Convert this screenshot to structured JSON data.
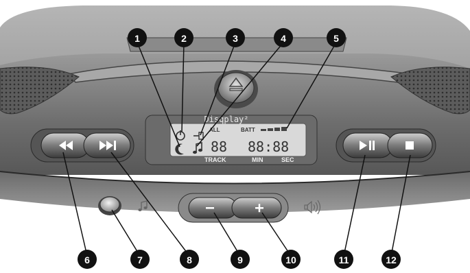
{
  "brand": "Disqplay²",
  "display": {
    "indicator_all": "ALL",
    "indicator_batt": "BATT",
    "digits_track": "88",
    "digits_time": "88:88",
    "label_track": "TRACK",
    "label_min": "MIN",
    "label_sec": "SEC"
  },
  "callouts": [
    "1",
    "2",
    "3",
    "4",
    "5",
    "6",
    "7",
    "8",
    "9",
    "10",
    "11",
    "12"
  ],
  "icons": {
    "sleep": "moon-icon",
    "power": "power-icon",
    "dc_in": "plug-icon",
    "anti_skip": "note-icon",
    "eject": "eject-icon",
    "rewind": "rewind-icon",
    "next": "next-track-icon",
    "play_pause": "play-pause-icon",
    "stop": "stop-icon",
    "volume": "speaker-icon"
  },
  "colors": {
    "body_dark": "#5a5a5a",
    "body_mid": "#8a8a8a",
    "lcd": "#d9d9d9",
    "callout": "#111111"
  }
}
